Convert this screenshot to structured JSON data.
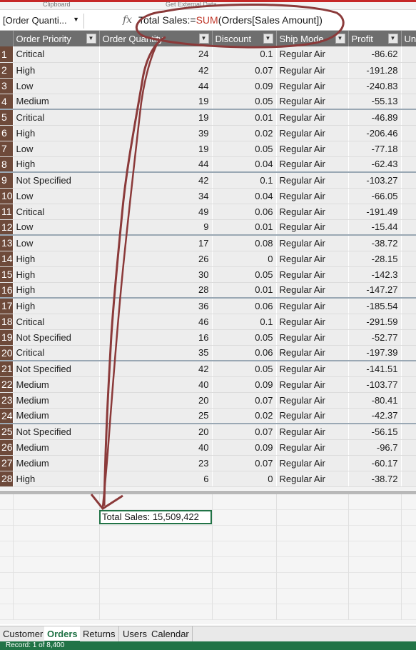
{
  "ribbon": {
    "group_left": "Clipboard",
    "group_right": "Get External Data"
  },
  "formula_bar": {
    "name_box": "[Order Quanti...",
    "fx": "fx",
    "formula_prefix": "Total Sales:=",
    "formula_func": "SUM",
    "formula_args": "(Orders[Sales Amount])"
  },
  "table": {
    "columns": [
      "Order Priority",
      "Order Quantity",
      "Discount",
      "Ship Mode",
      "Profit",
      "Uni"
    ],
    "rows": [
      [
        "1",
        "Critical",
        "24",
        "0.1",
        "Regular Air",
        "-86.62"
      ],
      [
        "2",
        "High",
        "42",
        "0.07",
        "Regular Air",
        "-191.28"
      ],
      [
        "3",
        "Low",
        "44",
        "0.09",
        "Regular Air",
        "-240.83"
      ],
      [
        "4",
        "Medium",
        "19",
        "0.05",
        "Regular Air",
        "-55.13"
      ],
      [
        "5",
        "Critical",
        "19",
        "0.01",
        "Regular Air",
        "-46.89"
      ],
      [
        "6",
        "High",
        "39",
        "0.02",
        "Regular Air",
        "-206.46"
      ],
      [
        "7",
        "Low",
        "19",
        "0.05",
        "Regular Air",
        "-77.18"
      ],
      [
        "8",
        "High",
        "44",
        "0.04",
        "Regular Air",
        "-62.43"
      ],
      [
        "9",
        "Not Specified",
        "42",
        "0.1",
        "Regular Air",
        "-103.27"
      ],
      [
        "10",
        "Low",
        "34",
        "0.04",
        "Regular Air",
        "-66.05"
      ],
      [
        "11",
        "Critical",
        "49",
        "0.06",
        "Regular Air",
        "-191.49"
      ],
      [
        "12",
        "Low",
        "9",
        "0.01",
        "Regular Air",
        "-15.44"
      ],
      [
        "13",
        "Low",
        "17",
        "0.08",
        "Regular Air",
        "-38.72"
      ],
      [
        "14",
        "High",
        "26",
        "0",
        "Regular Air",
        "-28.15"
      ],
      [
        "15",
        "High",
        "30",
        "0.05",
        "Regular Air",
        "-142.3"
      ],
      [
        "16",
        "High",
        "28",
        "0.01",
        "Regular Air",
        "-147.27"
      ],
      [
        "17",
        "High",
        "36",
        "0.06",
        "Regular Air",
        "-185.54"
      ],
      [
        "18",
        "Critical",
        "46",
        "0.1",
        "Regular Air",
        "-291.59"
      ],
      [
        "19",
        "Not Specified",
        "16",
        "0.05",
        "Regular Air",
        "-52.77"
      ],
      [
        "20",
        "Critical",
        "35",
        "0.06",
        "Regular Air",
        "-197.39"
      ],
      [
        "21",
        "Not Specified",
        "42",
        "0.05",
        "Regular Air",
        "-141.51"
      ],
      [
        "22",
        "Medium",
        "40",
        "0.09",
        "Regular Air",
        "-103.77"
      ],
      [
        "23",
        "Medium",
        "20",
        "0.07",
        "Regular Air",
        "-80.41"
      ],
      [
        "24",
        "Medium",
        "25",
        "0.02",
        "Regular Air",
        "-42.37"
      ],
      [
        "25",
        "Not Specified",
        "20",
        "0.07",
        "Regular Air",
        "-56.15"
      ],
      [
        "26",
        "Medium",
        "40",
        "0.09",
        "Regular Air",
        "-96.7"
      ],
      [
        "27",
        "Medium",
        "23",
        "0.07",
        "Regular Air",
        "-60.17"
      ],
      [
        "28",
        "High",
        "6",
        "0",
        "Regular Air",
        "-38.72"
      ]
    ]
  },
  "measure": {
    "text": "Total Sales: 15,509,422"
  },
  "sheet_tabs": [
    {
      "label": "Customer",
      "active": false
    },
    {
      "label": "Orders",
      "active": true
    },
    {
      "label": "Returns",
      "active": false
    },
    {
      "label": "Users",
      "active": false
    },
    {
      "label": "Calendar",
      "active": false
    }
  ],
  "status": {
    "text": "Record: 1 of 8,400"
  },
  "colors": {
    "accent": "#217346",
    "annotation": "#8b3a3a",
    "header_bg": "#6e6e6e",
    "row_number_bg": "#6e4a3a",
    "formula_func": "#c0392b"
  },
  "icons": {
    "filter": "filter-dropdown-icon",
    "fx": "function-icon",
    "name_box_dropdown": "chevron-down-icon"
  }
}
